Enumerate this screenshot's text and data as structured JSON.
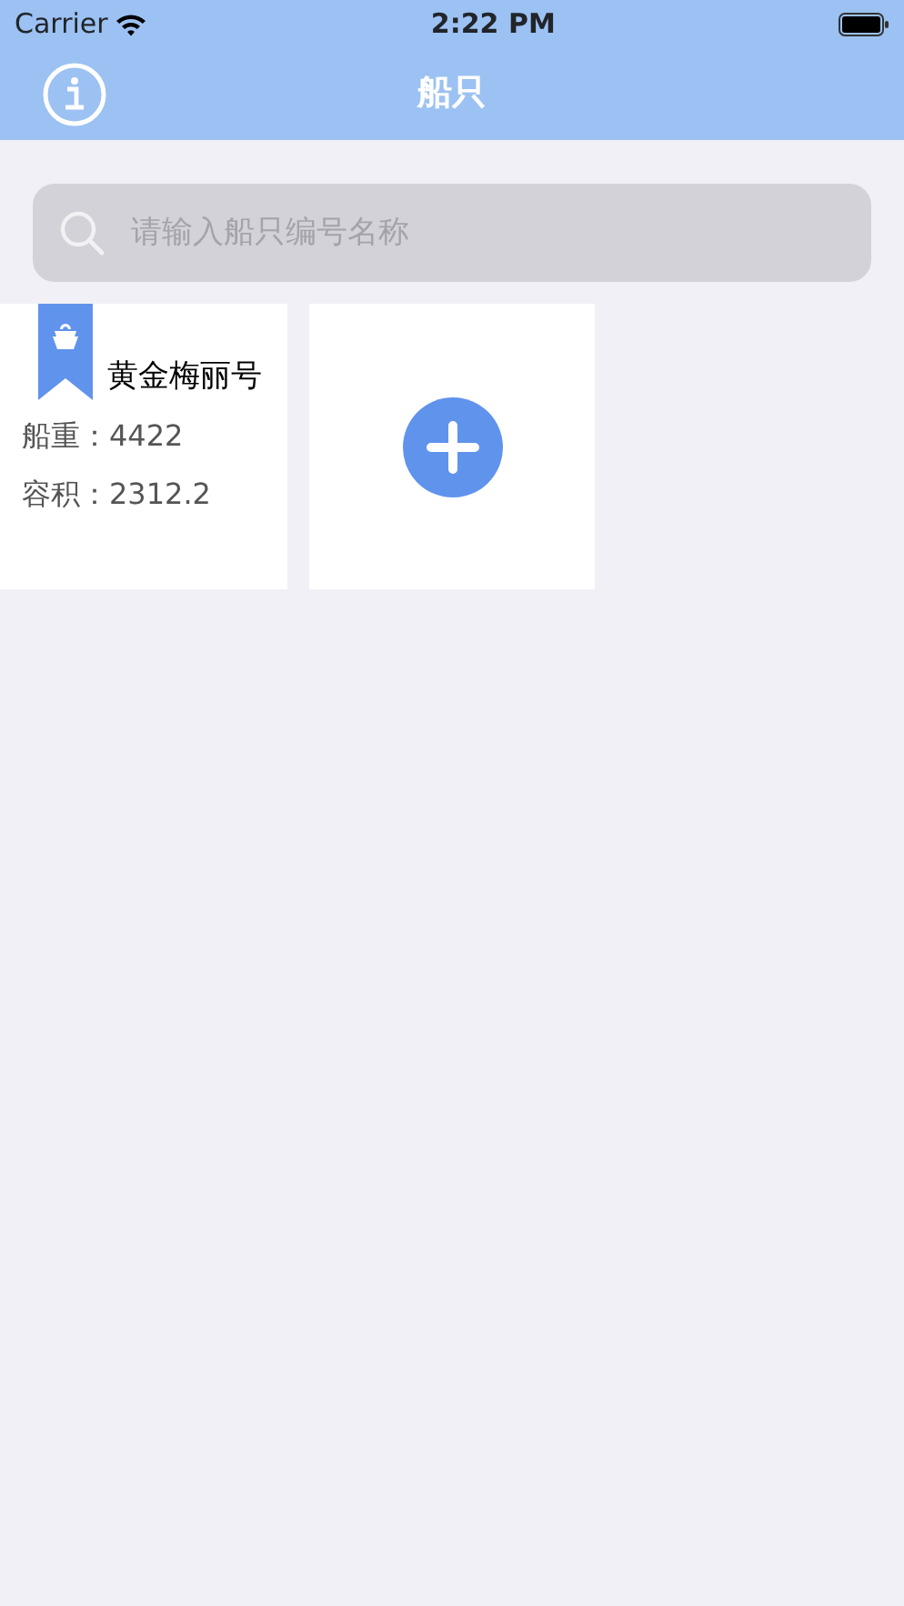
{
  "status_bar": {
    "carrier": "Carrier",
    "time": "2:22 PM"
  },
  "nav": {
    "title": "船只"
  },
  "search": {
    "placeholder": "请输入船只编号名称"
  },
  "ships": [
    {
      "name": "黄金梅丽号",
      "fields": [
        {
          "label": "船重：",
          "value": "4422"
        },
        {
          "label": "容积：",
          "value": "2312.2"
        }
      ]
    }
  ]
}
